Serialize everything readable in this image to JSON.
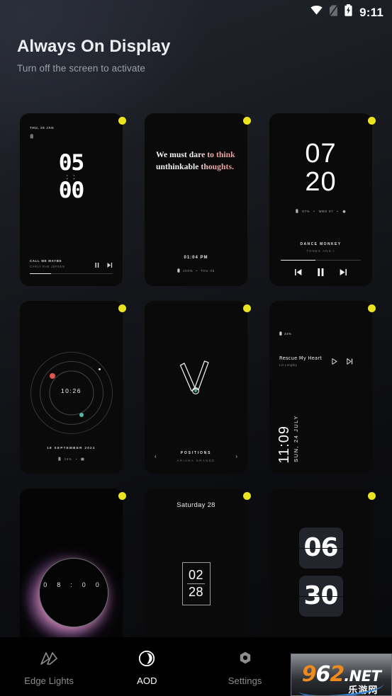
{
  "statusbar": {
    "time": "9:11",
    "icons": [
      "wifi-icon",
      "sim-off-icon",
      "battery-charging-icon"
    ]
  },
  "header": {
    "title": "Always On Display",
    "subtitle": "Turn off the screen to activate"
  },
  "cards": [
    {
      "id": "aod-style-dot-matrix",
      "badge": "yellow-dot-badge",
      "date": "THU, 28 JAN",
      "hours": "05",
      "minutes": "00",
      "music_title": "CALL ME MAYBE",
      "music_artist": "CARLY RAE JEPSEN",
      "progress": 26
    },
    {
      "id": "aod-style-quote",
      "badge": "yellow-dot-badge",
      "quote_part1": "We must dare to think unthink",
      "quote_part2": "able thoughts.",
      "quote_full": "We must dare to think unthinkable thoughts.",
      "time": "01:04 PM",
      "battery": "100%",
      "date": "THU 05"
    },
    {
      "id": "aod-style-big-clock-media",
      "badge": "yellow-dot-badge",
      "hours": "07",
      "minutes": "20",
      "battery": "97%",
      "date": "WED 07",
      "music_title": "DANCE MONKEY",
      "music_artist": "TONES AND I",
      "progress": 43
    },
    {
      "id": "aod-style-orbit",
      "badge": "yellow-dot-badge",
      "time": "10:26",
      "date": "18 SEPTEMBER 2022",
      "battery": "29%",
      "dot_colors": [
        "#e2574c",
        "#e8e8e8",
        "#53b7a8"
      ]
    },
    {
      "id": "aod-style-analog-hands",
      "badge": "yellow-dot-badge",
      "music_title": "POSITIONS",
      "music_artist": "ARIANA GRANDE",
      "prev": "‹",
      "next": "›"
    },
    {
      "id": "aod-style-vertical-time",
      "badge": "yellow-dot-badge",
      "battery": "34%",
      "music_title": "Rescue My Heart",
      "music_artist": "Liz Longley",
      "time": "11:09",
      "date": "SUN, 24 JULY"
    },
    {
      "id": "aod-style-eclipse",
      "badge": "yellow-dot-badge",
      "digits": [
        "0",
        "8",
        ":",
        "0",
        "0"
      ]
    },
    {
      "id": "aod-style-boxed-flip",
      "badge": "yellow-dot-badge",
      "day": "Saturday 28",
      "hours": "02",
      "minutes": "28"
    },
    {
      "id": "aod-style-flip-tiles",
      "badge": "yellow-dot-badge",
      "hours": "06",
      "minutes": "30"
    }
  ],
  "nav": {
    "items": [
      {
        "label": "Edge Lights",
        "icon": "edge-lights-icon",
        "active": false
      },
      {
        "label": "AOD",
        "icon": "aod-moon-icon",
        "active": true
      },
      {
        "label": "Settings",
        "icon": "gear-icon",
        "active": false
      },
      {
        "label": "",
        "icon": "star-icon",
        "active": false
      }
    ]
  },
  "watermark": {
    "num_9": "9",
    "num_6": "6",
    "num_2": "2",
    "net": ".NET",
    "cn": "乐游网"
  },
  "colors": {
    "badge": "#ece51d",
    "accent_text": "#ffffff",
    "muted_text": "#8d8d8d",
    "card_bg": "#0a0a0a",
    "nav_bg": "#000000"
  }
}
